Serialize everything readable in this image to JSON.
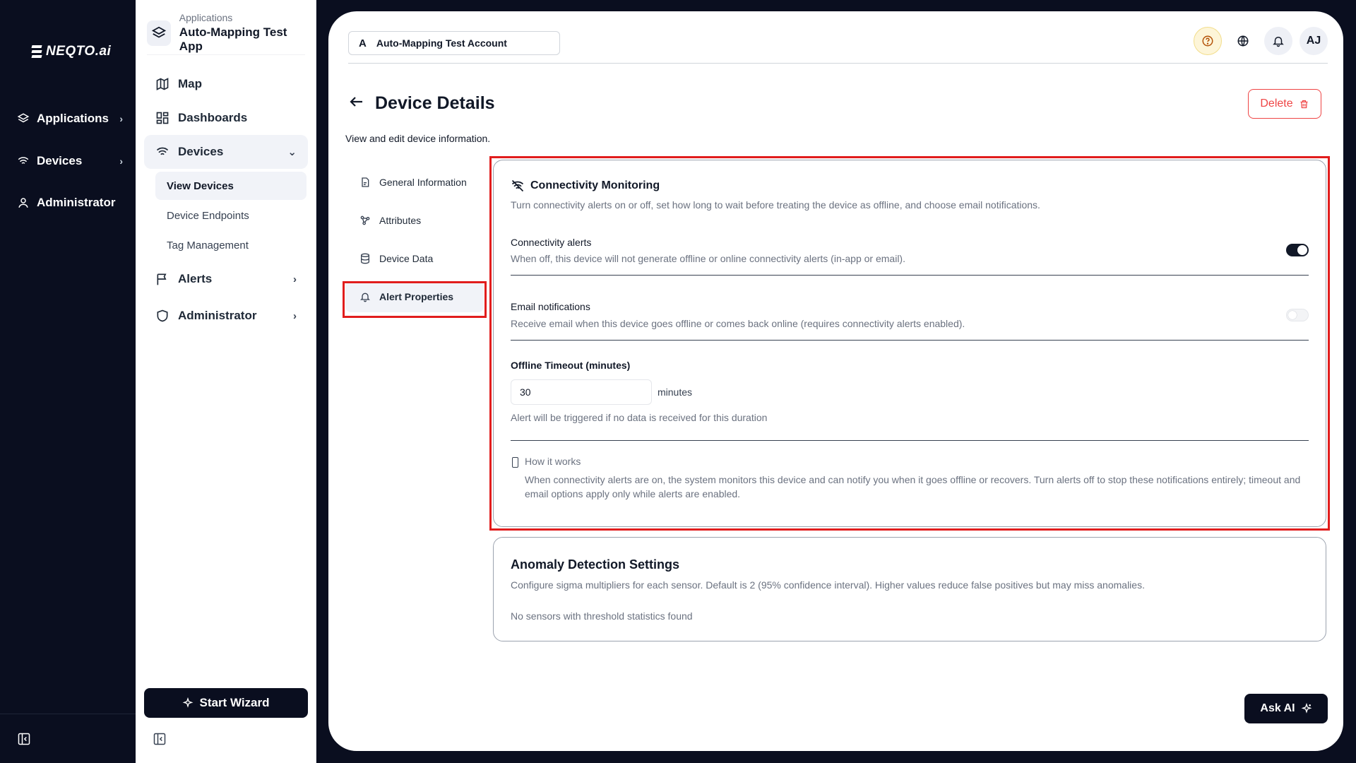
{
  "brand": {
    "logo_text": "NEQTO.ai"
  },
  "rail": {
    "items": [
      {
        "label": "Applications",
        "icon": "layers-icon"
      },
      {
        "label": "Devices",
        "icon": "wifi-icon"
      },
      {
        "label": "Administrator",
        "icon": "user-icon"
      }
    ]
  },
  "sidebar": {
    "app_sub": "Applications",
    "app_name": "Auto-Mapping Test App",
    "nav": [
      {
        "label": "Map",
        "icon": "map-icon"
      },
      {
        "label": "Dashboards",
        "icon": "dashboard-icon"
      },
      {
        "label": "Devices",
        "icon": "wifi-icon",
        "expanded": true
      },
      {
        "label": "Alerts",
        "icon": "flag-icon"
      },
      {
        "label": "Administrator",
        "icon": "shield-icon"
      }
    ],
    "devices_sub": [
      "View Devices",
      "Device Endpoints",
      "Tag Management"
    ],
    "start_wizard": "Start Wizard"
  },
  "topbar": {
    "account_avatar": "A",
    "account_name": "Auto-Mapping Test Account",
    "user_initials": "AJ"
  },
  "page": {
    "title": "Device Details",
    "subtitle": "View and edit device information.",
    "delete_label": "Delete"
  },
  "tabs": [
    "General Information",
    "Attributes",
    "Device Data",
    "Alert Properties"
  ],
  "connectivity": {
    "title": "Connectivity Monitoring",
    "desc": "Turn connectivity alerts on or off, set how long to wait before treating the device as offline, and choose email notifications.",
    "alerts_label": "Connectivity alerts",
    "alerts_desc": "When off, this device will not generate offline or online connectivity alerts (in-app or email).",
    "alerts_on": true,
    "email_label": "Email notifications",
    "email_desc": "Receive email when this device goes offline or comes back online (requires connectivity alerts enabled).",
    "email_on": false,
    "timeout_label": "Offline Timeout (minutes)",
    "timeout_value": "30",
    "timeout_unit": "minutes",
    "timeout_help": "Alert will be triggered if no data is received for this duration",
    "how_title": "How it works",
    "how_text": "When connectivity alerts are on, the system monitors this device and can notify you when it goes offline or recovers. Turn alerts off to stop these notifications entirely; timeout and email options apply only while alerts are enabled."
  },
  "anomaly": {
    "title": "Anomaly Detection Settings",
    "desc": "Configure sigma multipliers for each sensor. Default is 2 (95% confidence interval). Higher values reduce false positives but may miss anomalies.",
    "empty": "No sensors with threshold statistics found"
  },
  "ask_ai": "Ask AI",
  "colors": {
    "highlight": "#e11d1d",
    "dark": "#0a0e1f",
    "danger": "#ef4444"
  }
}
